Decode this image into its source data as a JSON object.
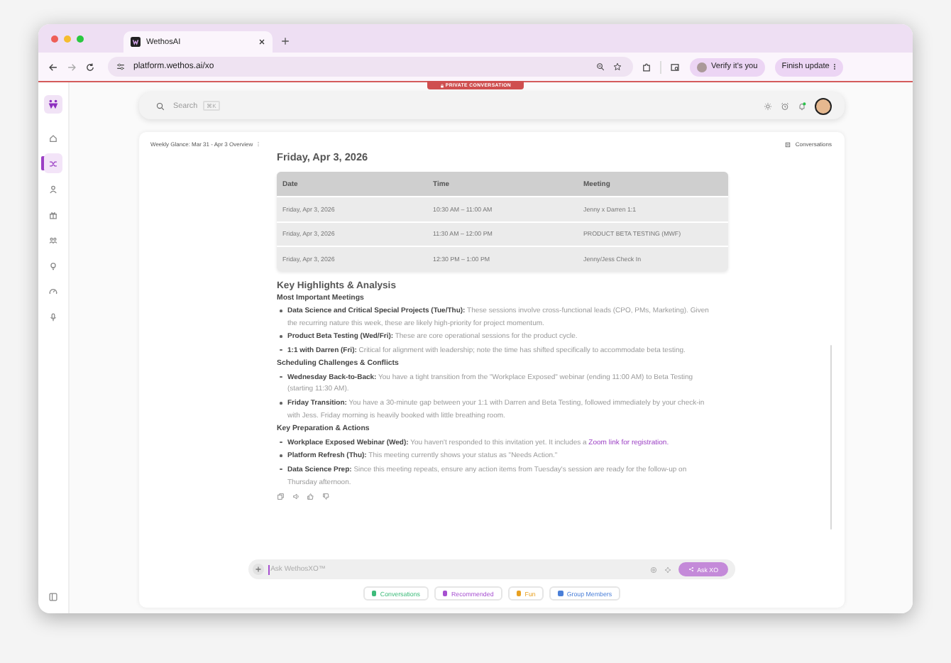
{
  "browser": {
    "tab_title": "WethosAI",
    "url": "platform.wethos.ai/xo",
    "buttons": [
      {
        "kind": "verify",
        "label": "Verify it's you"
      },
      {
        "kind": "update",
        "label": "Finish update"
      }
    ]
  },
  "banner": "PRIVATE CONVERSATION",
  "sidebar": {
    "items": [
      {
        "kind": "home",
        "selected": false
      },
      {
        "kind": "shuffle",
        "selected": true
      },
      {
        "kind": "person",
        "selected": false
      },
      {
        "kind": "gift",
        "selected": false
      },
      {
        "kind": "people",
        "selected": false
      },
      {
        "kind": "bulb",
        "selected": false
      },
      {
        "kind": "gauge",
        "selected": false
      },
      {
        "kind": "mic",
        "selected": false
      }
    ]
  },
  "search": {
    "placeholder": "Search",
    "shortcut": "⌘K"
  },
  "header": {
    "title": "Weekly Glance: Mar 31 - Apr 3 Overview",
    "conversations": "Conversations"
  },
  "day_heading": "Friday, Apr 3, 2026",
  "table": {
    "columns": [
      "Date",
      "Time",
      "Meeting"
    ],
    "rows": [
      [
        "Friday, Apr 3, 2026",
        "10:30 AM – 11:00 AM",
        "Jenny x Darren 1:1"
      ],
      [
        "Friday, Apr 3, 2026",
        "11:30 AM – 12:00 PM",
        "PRODUCT BETA TESTING (MWF)"
      ],
      [
        "Friday, Apr 3, 2026",
        "12:30 PM – 1:00 PM",
        "Jenny/Jess Check In"
      ]
    ]
  },
  "analysis": {
    "heading": "Key Highlights & Analysis",
    "sections": [
      {
        "title": "Most Important Meetings",
        "bullets": [
          {
            "lead": "Data Science and Critical Special Projects (Tue/Thu):",
            "text": "These sessions involve cross-functional leads (CPO, PMs, Marketing). Given the recurring nature this week, these are likely high-priority for project momentum."
          },
          {
            "lead": "Product Beta Testing (Wed/Fri):",
            "text": "These are core operational sessions for the product cycle."
          },
          {
            "lead": "1:1 with Darren (Fri):",
            "text": "Critical for alignment with leadership; note the time has shifted specifically to accommodate beta testing."
          }
        ]
      },
      {
        "title": "Scheduling Challenges & Conflicts",
        "bullets": [
          {
            "lead": "Wednesday Back-to-Back:",
            "text": "You have a tight transition from the \"Workplace Exposed\" webinar (ending 11:00 AM) to Beta Testing (starting 11:30 AM)."
          },
          {
            "lead": "Friday Transition:",
            "text": "You have a 30-minute gap between your 1:1 with Darren and Beta Testing, followed immediately by your check-in with Jess. Friday morning is heavily booked with little breathing room."
          }
        ]
      },
      {
        "title": "Key Preparation & Actions",
        "bullets": [
          {
            "lead": "Workplace Exposed Webinar (Wed):",
            "text": "You haven't responded to this invitation yet. It includes a",
            "link": "Zoom link for registration."
          },
          {
            "lead": "Platform Refresh (Thu):",
            "text": "This meeting currently shows your status as \"Needs Action.\""
          },
          {
            "lead": "Data Science Prep:",
            "text": "Since this meeting repeats, ensure any action items from Tuesday's session are ready for the follow-up on Thursday afternoon."
          }
        ]
      }
    ]
  },
  "composer": {
    "placeholder": "Ask WethosXO™",
    "button": "Ask XO"
  },
  "chips": [
    {
      "label": "Conversations",
      "color": "#3dbb7a"
    },
    {
      "label": "Recommended",
      "color": "#a64fd0"
    },
    {
      "label": "Fun",
      "color": "#e8a020"
    },
    {
      "label": "Group Members",
      "color": "#4a7fd8"
    }
  ]
}
